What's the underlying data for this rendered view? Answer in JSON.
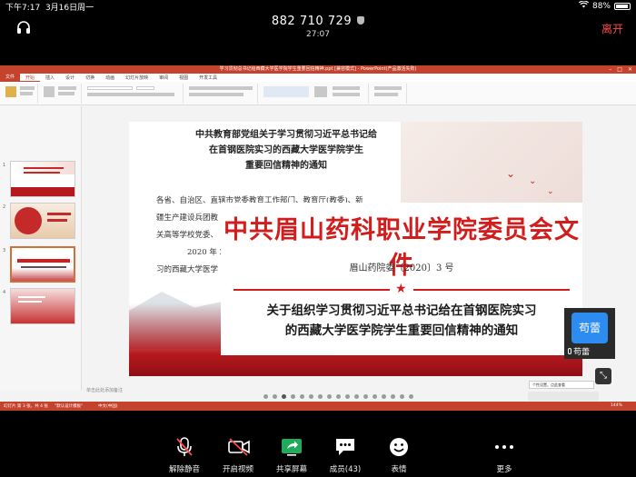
{
  "status_bar": {
    "time": "下午7:17",
    "date": "3月16日周一",
    "battery": "88%"
  },
  "meeting": {
    "id": "882 710 729",
    "duration": "27:07",
    "leave_label": "离开"
  },
  "ppt": {
    "window_title": "学习贯彻总书记给西藏大学医学院学生重要回信精神.ppt [兼容模式] - PowerPoint(产品激活失败)",
    "tabs": [
      "文件",
      "开始",
      "插入",
      "设计",
      "切换",
      "动画",
      "幻灯片放映",
      "审阅",
      "视图",
      "开发工具"
    ],
    "notes_placeholder": "单击此处添加备注",
    "status_left": "幻灯片 第 3 张，共 4 张",
    "status_theme": "\"默认设计模板\"",
    "status_lang": "中文(中国)",
    "zoom": "144%",
    "toast": "个性设置，点此查看"
  },
  "thumbnails": [
    {
      "num": "1"
    },
    {
      "num": "2"
    },
    {
      "num": "3"
    },
    {
      "num": "4"
    }
  ],
  "slide": {
    "heading_lines": [
      "中共教育部党组关于学习贯彻习近平总书记给",
      "在首钢医院实习的西藏大学医学院学生",
      "重要回信精神的通知"
    ],
    "body_lines": [
      "各省、自治区、直辖市党委教育工作部门、教育厅(教委)、新",
      "疆生产建设兵团教",
      "关高等学校党委、",
      "2020 年 2 月",
      "习的西藏大学医学"
    ]
  },
  "notice": {
    "title": "中共眉山药科职业学院委员会文件",
    "code": "眉山药院委〔2020〕3 号",
    "subtitle_line1": "关于组织学习贯彻习近平总书记给在首钢医院实习",
    "subtitle_line2": "的西藏大学医学院学生重要回信精神的通知"
  },
  "participant": {
    "avatar_text": "苟蕾",
    "name": "苟蕾"
  },
  "toolbar": {
    "unmute": "解除静音",
    "start_video": "开启视频",
    "share_screen": "共享屏幕",
    "members": "成员(43)",
    "emoji": "表情",
    "more": "更多"
  },
  "colors": {
    "ppt_accent": "#c4432d",
    "notice_red": "#d21d1d",
    "leave_red": "#ff4a4a",
    "avatar_blue": "#2d8cf0"
  }
}
